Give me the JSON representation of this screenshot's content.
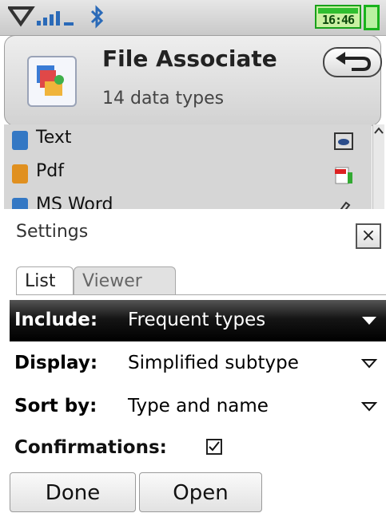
{
  "status": {
    "clock": "16:46"
  },
  "header": {
    "title": "File Associate",
    "subtitle": "14 data types"
  },
  "file_types": [
    {
      "label": "Text",
      "color": "#3478c4"
    },
    {
      "label": "Pdf",
      "color": "#e09020"
    },
    {
      "label": "MS Word",
      "color": "#3478c4"
    }
  ],
  "settings": {
    "title": "Settings",
    "close_label": "×",
    "tabs": [
      {
        "label": "List"
      },
      {
        "label": "Viewer"
      }
    ],
    "options": [
      {
        "label": "Include:",
        "value": "Frequent types"
      },
      {
        "label": "Display:",
        "value": "Simplified subtype"
      },
      {
        "label": "Sort by:",
        "value": "Type and name"
      }
    ],
    "confirmations_label": "Confirmations:",
    "confirmations_checked": true
  },
  "buttons": {
    "done": "Done",
    "open": "Open"
  }
}
